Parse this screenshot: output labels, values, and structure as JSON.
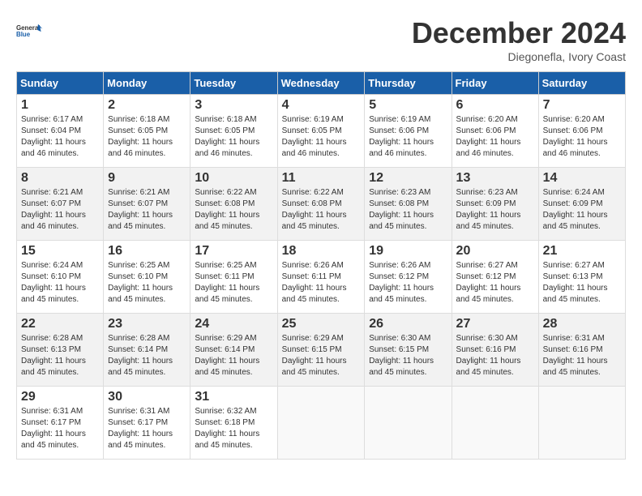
{
  "header": {
    "logo_line1": "General",
    "logo_line2": "Blue",
    "month": "December 2024",
    "location": "Diegonefla, Ivory Coast"
  },
  "days_of_week": [
    "Sunday",
    "Monday",
    "Tuesday",
    "Wednesday",
    "Thursday",
    "Friday",
    "Saturday"
  ],
  "weeks": [
    [
      {
        "day": "1",
        "sunrise": "6:17 AM",
        "sunset": "6:04 PM",
        "daylight": "11 hours and 46 minutes."
      },
      {
        "day": "2",
        "sunrise": "6:18 AM",
        "sunset": "6:05 PM",
        "daylight": "11 hours and 46 minutes."
      },
      {
        "day": "3",
        "sunrise": "6:18 AM",
        "sunset": "6:05 PM",
        "daylight": "11 hours and 46 minutes."
      },
      {
        "day": "4",
        "sunrise": "6:19 AM",
        "sunset": "6:05 PM",
        "daylight": "11 hours and 46 minutes."
      },
      {
        "day": "5",
        "sunrise": "6:19 AM",
        "sunset": "6:06 PM",
        "daylight": "11 hours and 46 minutes."
      },
      {
        "day": "6",
        "sunrise": "6:20 AM",
        "sunset": "6:06 PM",
        "daylight": "11 hours and 46 minutes."
      },
      {
        "day": "7",
        "sunrise": "6:20 AM",
        "sunset": "6:06 PM",
        "daylight": "11 hours and 46 minutes."
      }
    ],
    [
      {
        "day": "8",
        "sunrise": "6:21 AM",
        "sunset": "6:07 PM",
        "daylight": "11 hours and 46 minutes."
      },
      {
        "day": "9",
        "sunrise": "6:21 AM",
        "sunset": "6:07 PM",
        "daylight": "11 hours and 45 minutes."
      },
      {
        "day": "10",
        "sunrise": "6:22 AM",
        "sunset": "6:08 PM",
        "daylight": "11 hours and 45 minutes."
      },
      {
        "day": "11",
        "sunrise": "6:22 AM",
        "sunset": "6:08 PM",
        "daylight": "11 hours and 45 minutes."
      },
      {
        "day": "12",
        "sunrise": "6:23 AM",
        "sunset": "6:08 PM",
        "daylight": "11 hours and 45 minutes."
      },
      {
        "day": "13",
        "sunrise": "6:23 AM",
        "sunset": "6:09 PM",
        "daylight": "11 hours and 45 minutes."
      },
      {
        "day": "14",
        "sunrise": "6:24 AM",
        "sunset": "6:09 PM",
        "daylight": "11 hours and 45 minutes."
      }
    ],
    [
      {
        "day": "15",
        "sunrise": "6:24 AM",
        "sunset": "6:10 PM",
        "daylight": "11 hours and 45 minutes."
      },
      {
        "day": "16",
        "sunrise": "6:25 AM",
        "sunset": "6:10 PM",
        "daylight": "11 hours and 45 minutes."
      },
      {
        "day": "17",
        "sunrise": "6:25 AM",
        "sunset": "6:11 PM",
        "daylight": "11 hours and 45 minutes."
      },
      {
        "day": "18",
        "sunrise": "6:26 AM",
        "sunset": "6:11 PM",
        "daylight": "11 hours and 45 minutes."
      },
      {
        "day": "19",
        "sunrise": "6:26 AM",
        "sunset": "6:12 PM",
        "daylight": "11 hours and 45 minutes."
      },
      {
        "day": "20",
        "sunrise": "6:27 AM",
        "sunset": "6:12 PM",
        "daylight": "11 hours and 45 minutes."
      },
      {
        "day": "21",
        "sunrise": "6:27 AM",
        "sunset": "6:13 PM",
        "daylight": "11 hours and 45 minutes."
      }
    ],
    [
      {
        "day": "22",
        "sunrise": "6:28 AM",
        "sunset": "6:13 PM",
        "daylight": "11 hours and 45 minutes."
      },
      {
        "day": "23",
        "sunrise": "6:28 AM",
        "sunset": "6:14 PM",
        "daylight": "11 hours and 45 minutes."
      },
      {
        "day": "24",
        "sunrise": "6:29 AM",
        "sunset": "6:14 PM",
        "daylight": "11 hours and 45 minutes."
      },
      {
        "day": "25",
        "sunrise": "6:29 AM",
        "sunset": "6:15 PM",
        "daylight": "11 hours and 45 minutes."
      },
      {
        "day": "26",
        "sunrise": "6:30 AM",
        "sunset": "6:15 PM",
        "daylight": "11 hours and 45 minutes."
      },
      {
        "day": "27",
        "sunrise": "6:30 AM",
        "sunset": "6:16 PM",
        "daylight": "11 hours and 45 minutes."
      },
      {
        "day": "28",
        "sunrise": "6:31 AM",
        "sunset": "6:16 PM",
        "daylight": "11 hours and 45 minutes."
      }
    ],
    [
      {
        "day": "29",
        "sunrise": "6:31 AM",
        "sunset": "6:17 PM",
        "daylight": "11 hours and 45 minutes."
      },
      {
        "day": "30",
        "sunrise": "6:31 AM",
        "sunset": "6:17 PM",
        "daylight": "11 hours and 45 minutes."
      },
      {
        "day": "31",
        "sunrise": "6:32 AM",
        "sunset": "6:18 PM",
        "daylight": "11 hours and 45 minutes."
      },
      null,
      null,
      null,
      null
    ]
  ],
  "labels": {
    "sunrise": "Sunrise:",
    "sunset": "Sunset:",
    "daylight": "Daylight:"
  }
}
